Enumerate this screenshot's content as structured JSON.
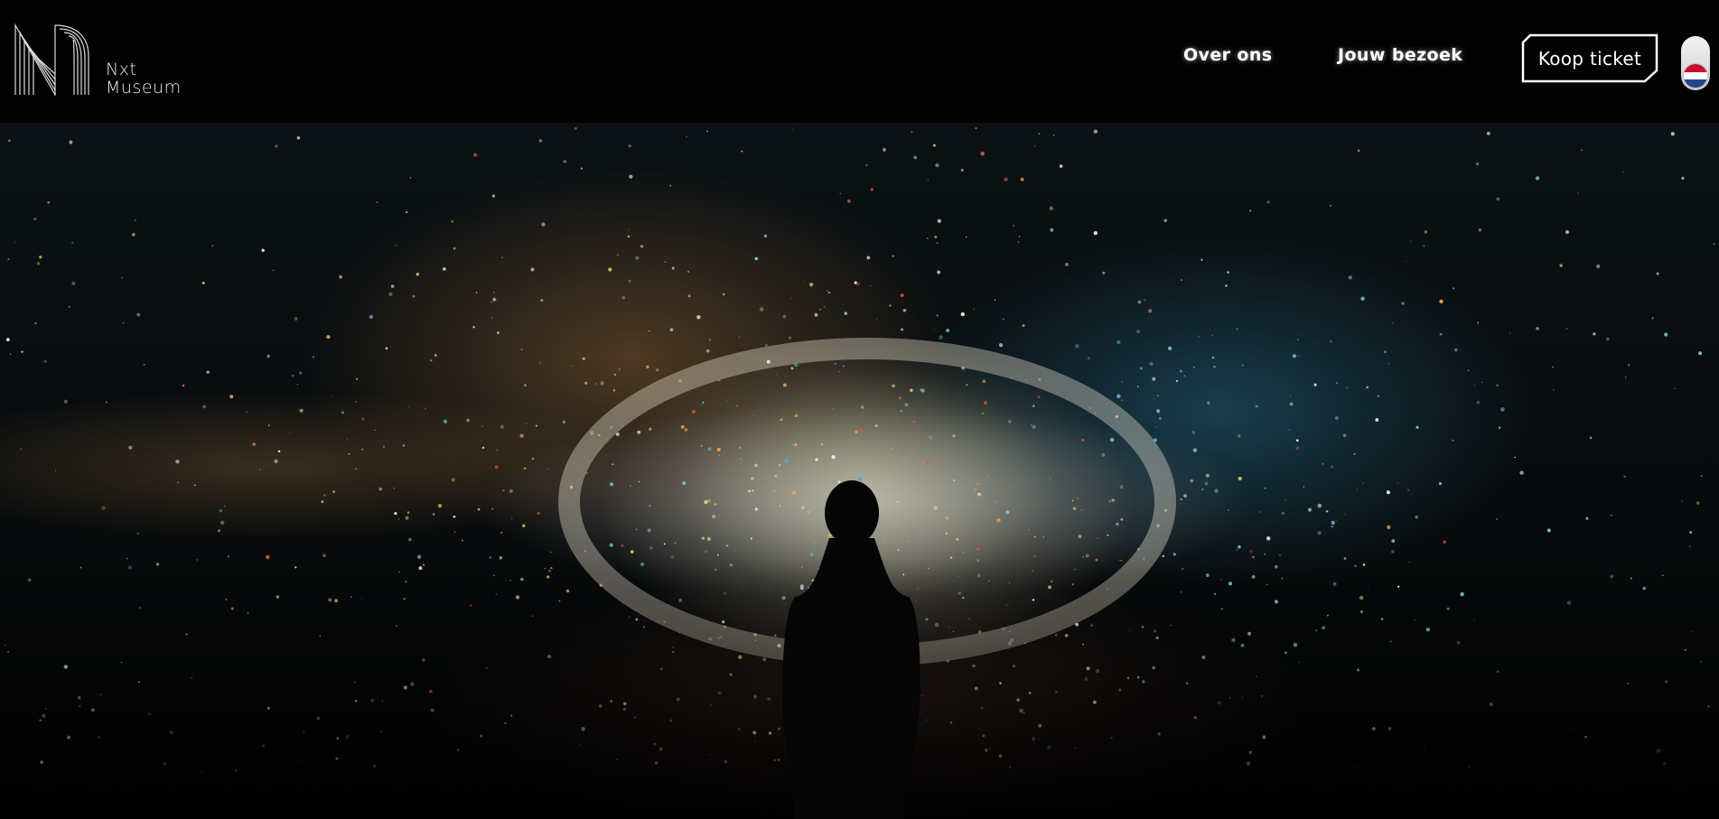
{
  "header": {
    "logo": {
      "line1": "Nxt",
      "line2": "Museum",
      "icon": "nxt-museum-logo-icon"
    },
    "nav": [
      {
        "label": "Over ons"
      },
      {
        "label": "Jouw bezoek"
      }
    ],
    "ticket_button": {
      "label": "Koop ticket"
    },
    "language_toggle": {
      "current": "NL",
      "icon": "netherlands-flag-icon"
    }
  },
  "colors": {
    "header_bg": "#020202",
    "nav_text": "#ffffff",
    "flag_red": "#c8102e",
    "flag_white": "#ffffff",
    "flag_blue": "#21468b"
  }
}
